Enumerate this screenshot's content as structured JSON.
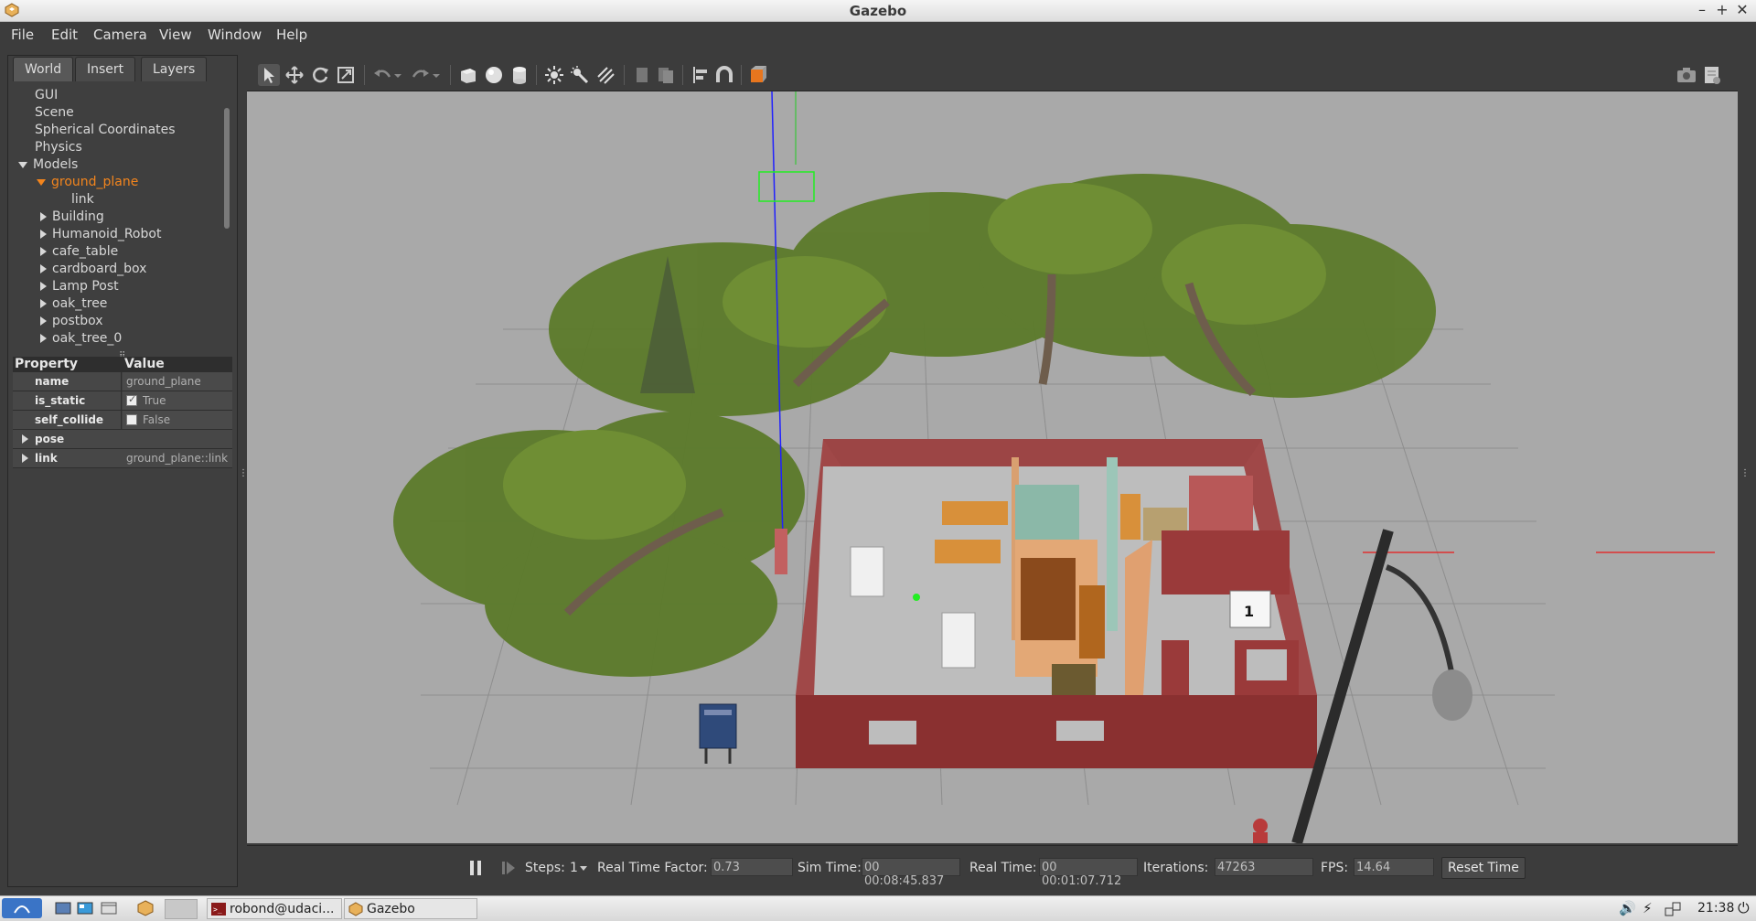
{
  "window": {
    "title": "Gazebo"
  },
  "menu": [
    "File",
    "Edit",
    "Camera",
    "View",
    "Window",
    "Help"
  ],
  "tabs": [
    "World",
    "Insert",
    "Layers"
  ],
  "tree": {
    "items": [
      "GUI",
      "Scene",
      "Spherical Coordinates",
      "Physics",
      "Models",
      "ground_plane",
      "link",
      "Building",
      "Humanoid_Robot",
      "cafe_table",
      "cardboard_box",
      "Lamp Post",
      "oak_tree",
      "postbox",
      "oak_tree_0"
    ]
  },
  "props": {
    "header_property": "Property",
    "header_value": "Value",
    "name_key": "name",
    "name_value": "ground_plane",
    "is_static_key": "is_static",
    "is_static_value": "True",
    "self_collide_key": "self_collide",
    "self_collide_value": "False",
    "pose_key": "pose",
    "link_key": "link",
    "link_value": "ground_plane::link"
  },
  "bottom": {
    "steps_label": "Steps:",
    "steps_value": "1",
    "rtf_label": "Real Time Factor:",
    "rtf_value": "0.73",
    "sim_label": "Sim Time:",
    "sim_value": "00 00:08:45.837",
    "real_label": "Real Time:",
    "real_value": "00 00:01:07.712",
    "iter_label": "Iterations:",
    "iter_value": "47263",
    "fps_label": "FPS:",
    "fps_value": "14.64",
    "reset_label": "Reset Time"
  },
  "taskbar": {
    "task1": "robond@udaci...",
    "task2": "Gazebo",
    "clock": "21:38"
  },
  "colors": {
    "selection": "#f3851d",
    "viewport_bg": "#a9a9a9",
    "panel_bg": "#3f3f3f"
  },
  "icons": [
    "select-icon",
    "translate-icon",
    "rotate-icon",
    "scale-icon",
    "undo-icon",
    "redo-icon",
    "box-icon",
    "sphere-icon",
    "cylinder-icon",
    "point-light-icon",
    "spot-light-icon",
    "directional-light-icon",
    "copy-icon",
    "paste-icon",
    "align-icon",
    "snap-icon",
    "view-angle-icon",
    "screenshot-icon",
    "log-icon"
  ]
}
